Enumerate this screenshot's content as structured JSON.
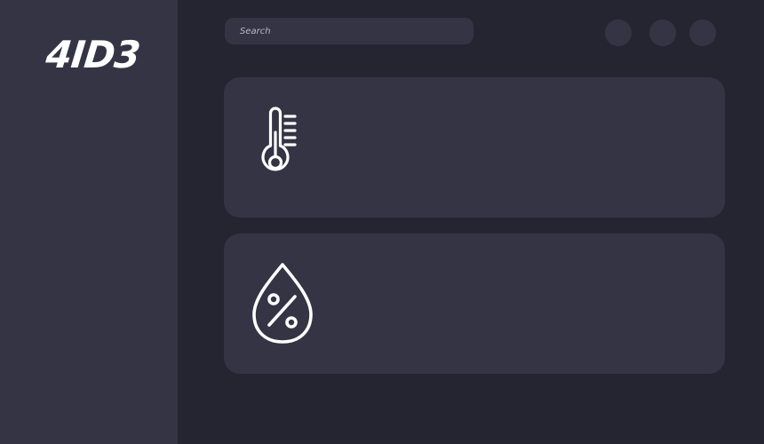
{
  "sidebar": {
    "logo_text": "4ID3"
  },
  "header": {
    "search": {
      "placeholder": "Search",
      "icon": "none"
    },
    "action_buttons": [
      {
        "icon": "circle"
      },
      {
        "icon": "circle"
      },
      {
        "icon": "circle"
      }
    ]
  },
  "cards": [
    {
      "icon": "thermometer-icon"
    },
    {
      "icon": "humidity-icon"
    }
  ],
  "colors": {
    "background": "#252531",
    "sidebar": "#353445",
    "card": "#353445",
    "search": "#353445",
    "text": "#ffffff",
    "placeholder": "#b9b8c7"
  }
}
